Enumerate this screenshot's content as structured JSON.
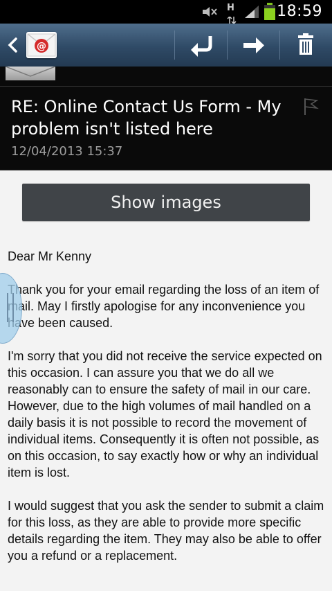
{
  "status_bar": {
    "time": "18:59",
    "network_label": "H",
    "icons": [
      "mute-icon",
      "network-h-icon",
      "signal-icon",
      "battery-icon"
    ]
  },
  "action_bar": {
    "back_icon": "chevron-left-icon",
    "app_icon": "email-app-icon",
    "buttons": [
      {
        "name": "reply-button",
        "icon": "reply-icon"
      },
      {
        "name": "forward-button",
        "icon": "forward-icon"
      },
      {
        "name": "delete-button",
        "icon": "trash-icon"
      }
    ]
  },
  "header": {
    "subject": "RE: Online Contact Us Form - My problem isn't listed here",
    "date": "12/04/2013  15:37",
    "flag_icon": "flag-icon"
  },
  "show_images_label": "Show images",
  "body": {
    "greeting": "Dear Mr Kenny",
    "paragraphs": [
      "Thank you for your email regarding the loss of an item of mail. May I firstly apologise for any inconvenience you have been caused.",
      "I'm sorry that you did not receive the service expected on this occasion. I can assure you that we do all we reasonably can to ensure the safety of mail in our care. However, due to the high volumes of mail handled on a daily basis it is not possible to record the movement of individual items. Consequently it is often not possible, as on this occasion, to say exactly how or why an individual item is lost.",
      "I would suggest that you ask the sender to submit a claim for this loss, as they are able to provide more specific details regarding the item. They may also be able to offer you a refund or a replacement."
    ]
  },
  "colors": {
    "action_bar": "#2f4a66",
    "header_bg": "#0a0a0a",
    "button_bg": "#404448",
    "page_bg": "#f3f3f3"
  }
}
